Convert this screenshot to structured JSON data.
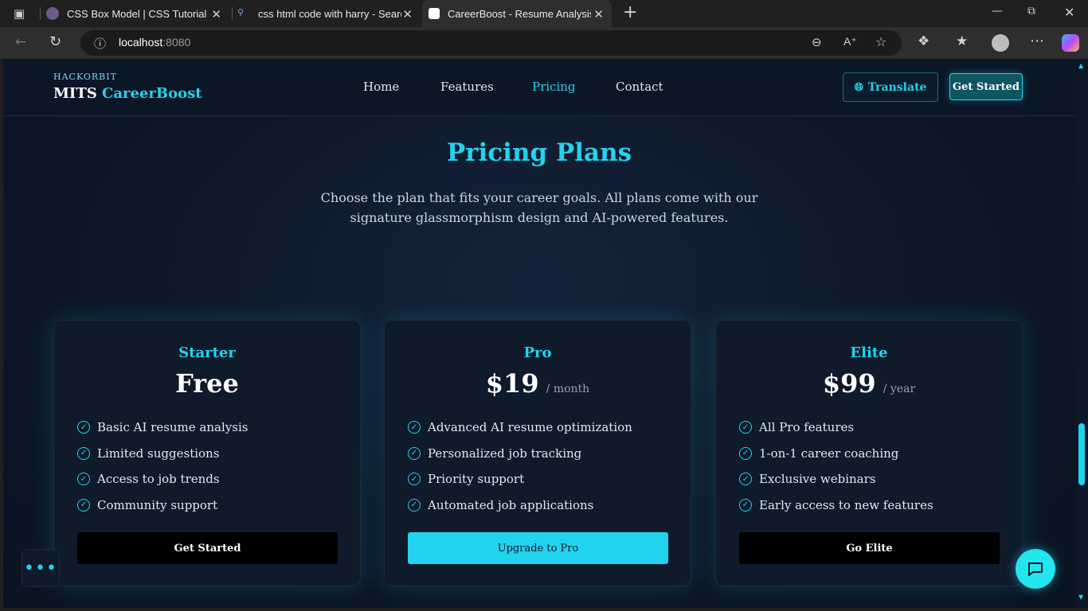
{
  "browser": {
    "tabs": [
      {
        "title": "CSS Box Model | CSS Tutorial | Co",
        "favicon_color": "#6b5b8c"
      },
      {
        "title": "css html code with harry - Search",
        "favicon_color": "#4a4a4a"
      },
      {
        "title": "CareerBoost - Resume Analysis &",
        "favicon_color": "#ffffff"
      }
    ],
    "new_tab_glyph": "+",
    "url_host": "localhost",
    "url_port": ":8080"
  },
  "nav": {
    "brand_small": "HACKORBIT",
    "brand_main": "MITS",
    "brand_accent": "CareerBoost",
    "links": [
      "Home",
      "Features",
      "Pricing",
      "Contact"
    ],
    "active_link": "Pricing",
    "translate_label": "Translate",
    "get_started_label": "Get Started"
  },
  "pricing": {
    "title": "Pricing Plans",
    "subtitle": "Choose the plan that fits your career goals. All plans come with our signature glassmorphism design and AI-powered features.",
    "plans": [
      {
        "name": "Starter",
        "price": "Free",
        "period": "",
        "features": [
          "Basic AI resume analysis",
          "Limited suggestions",
          "Access to job trends",
          "Community support"
        ],
        "cta": "Get Started"
      },
      {
        "name": "Pro",
        "price": "$19",
        "period": "/ month",
        "features": [
          "Advanced AI resume optimization",
          "Personalized job tracking",
          "Priority support",
          "Automated job applications"
        ],
        "cta": "Upgrade to Pro"
      },
      {
        "name": "Elite",
        "price": "$99",
        "period": "/ year",
        "features": [
          "All Pro features",
          "1-on-1 career coaching",
          "Exclusive webinars",
          "Early access to new features"
        ],
        "cta": "Go Elite"
      }
    ]
  },
  "colors": {
    "accent": "#22d3ee",
    "background": "#0d1728",
    "card": "#0f1a2b"
  }
}
